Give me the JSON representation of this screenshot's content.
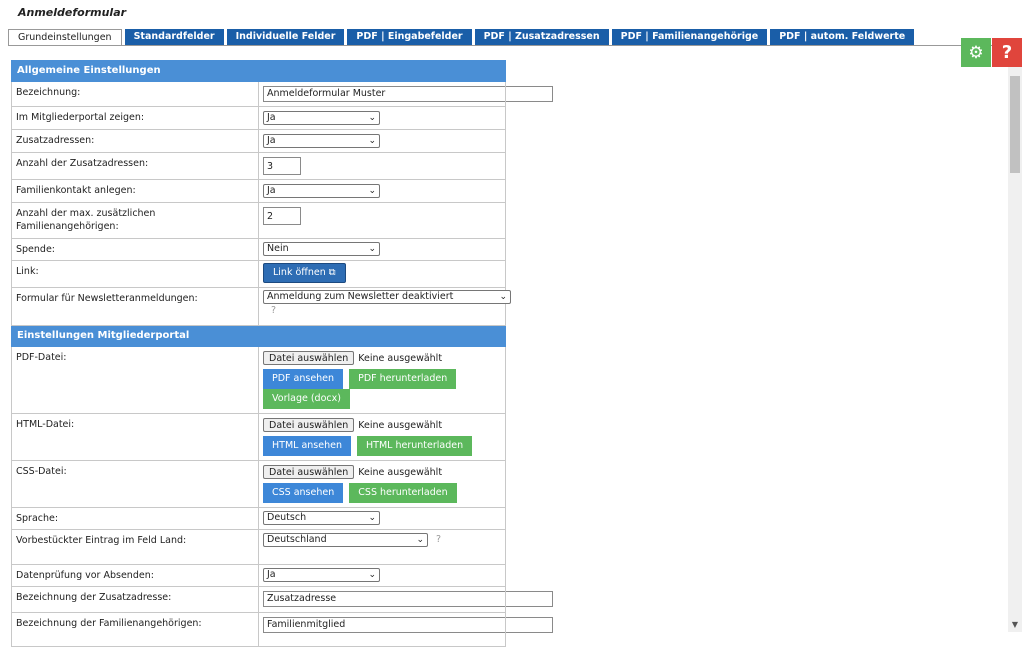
{
  "page_title": "Anmeldeformular",
  "tabs": [
    {
      "label": "Grundeinstellungen",
      "active": true
    },
    {
      "label": "Standardfelder"
    },
    {
      "label": "Individuelle Felder"
    },
    {
      "label": "PDF | Eingabefelder"
    },
    {
      "label": "PDF | Zusatzadressen"
    },
    {
      "label": "PDF | Familienangehörige"
    },
    {
      "label": "PDF | autom. Feldwerte"
    }
  ],
  "colors": {
    "tab_blue": "#1a5ea8",
    "section_blue": "#4a8fd6",
    "button_blue": "#3d87d8",
    "button_green": "#5cb85c",
    "help_red": "#e0453c"
  },
  "top_right": {
    "settings_icon": "gear-icon",
    "help_icon": "question-icon",
    "help_glyph": "?"
  },
  "sections": {
    "general": "Allgemeine Einstellungen",
    "portal": "Einstellungen Mitgliederportal"
  },
  "fields": {
    "bezeichnung": {
      "label": "Bezeichnung:",
      "value": "Anmeldeformular Muster"
    },
    "mitgliederportal": {
      "label": "Im Mitgliederportal zeigen:",
      "value": "Ja"
    },
    "zusatzadressen": {
      "label": "Zusatzadressen:",
      "value": "Ja"
    },
    "anzahl_zusatz": {
      "label": "Anzahl der Zusatzadressen:",
      "value": "3"
    },
    "familienkontakt": {
      "label": "Familienkontakt anlegen:",
      "value": "Ja"
    },
    "anzahl_familie": {
      "label": "Anzahl der max. zusätzlichen Familienangehörigen:",
      "value": "2"
    },
    "spende": {
      "label": "Spende:",
      "value": "Nein"
    },
    "link": {
      "label": "Link:",
      "button": "Link öffnen",
      "icon": "copy-icon"
    },
    "newsletter": {
      "label": "Formular für Newsletteranmeldungen:",
      "value": "Anmeldung zum Newsletter deaktiviert",
      "hint": "?"
    },
    "pdf": {
      "label": "PDF-Datei:",
      "choose": "Datei auswählen",
      "status": "Keine ausgewählt",
      "buttons": [
        "PDF ansehen",
        "PDF herunterladen",
        "Vorlage (docx)"
      ]
    },
    "html": {
      "label": "HTML-Datei:",
      "choose": "Datei auswählen",
      "status": "Keine ausgewählt",
      "buttons": [
        "HTML ansehen",
        "HTML herunterladen"
      ]
    },
    "css": {
      "label": "CSS-Datei:",
      "choose": "Datei auswählen",
      "status": "Keine ausgewählt",
      "buttons": [
        "CSS ansehen",
        "CSS herunterladen"
      ]
    },
    "sprache": {
      "label": "Sprache:",
      "value": "Deutsch"
    },
    "land": {
      "label": "Vorbestückter Eintrag im Feld Land:",
      "value": "Deutschland",
      "hint": "?"
    },
    "datenpruefung": {
      "label": "Datenprüfung vor Absenden:",
      "value": "Ja"
    },
    "zusatz_bez": {
      "label": "Bezeichnung der Zusatzadresse:",
      "value": "Zusatzadresse"
    },
    "familie_bez": {
      "label": "Bezeichnung der Familienangehörigen:",
      "value": "Familienmitglied"
    }
  }
}
